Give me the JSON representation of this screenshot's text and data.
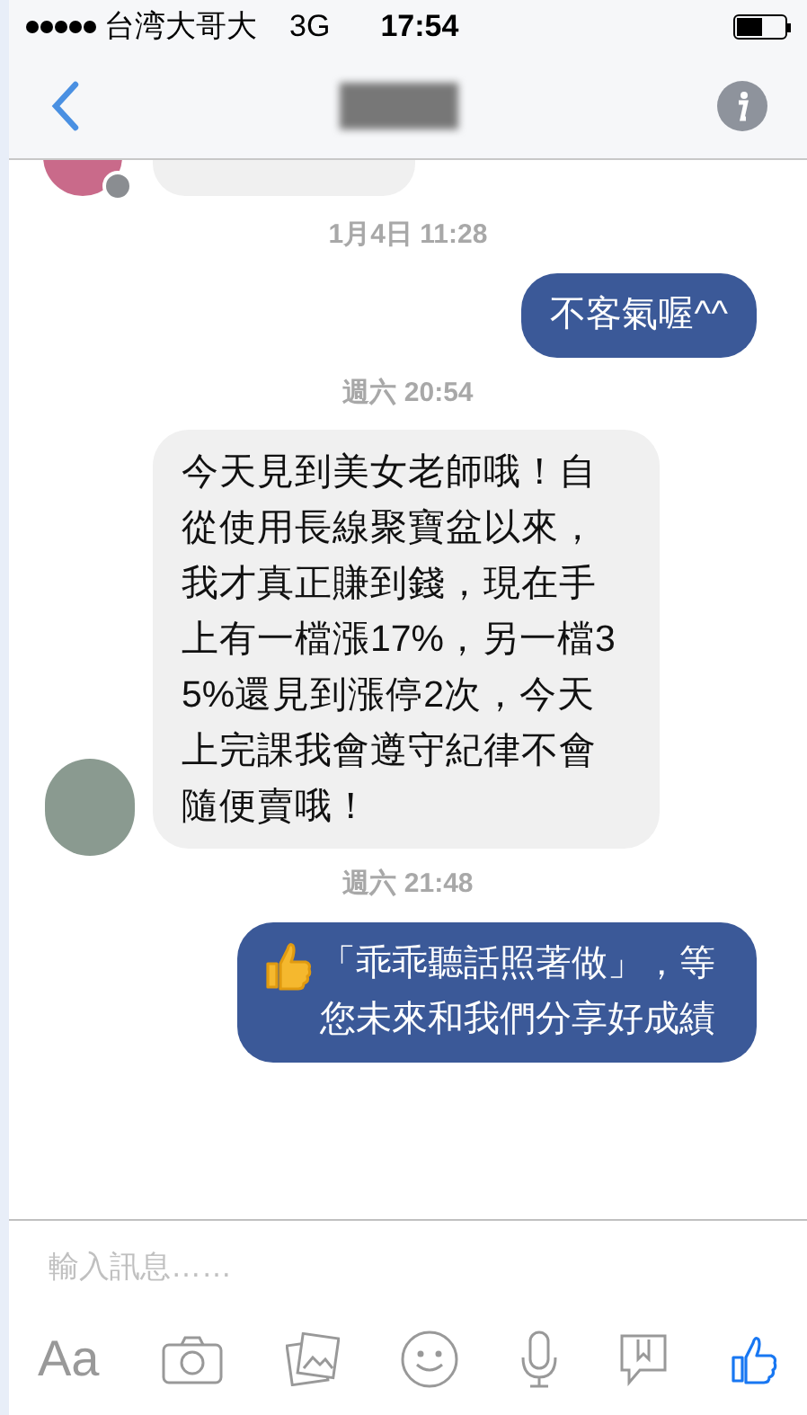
{
  "status_bar": {
    "carrier": "台湾大哥大",
    "network": "3G",
    "time": "17:54"
  },
  "messages": [
    {
      "kind": "partial_incoming"
    },
    {
      "kind": "timestamp",
      "text": "1月4日 11:28"
    },
    {
      "kind": "outgoing",
      "text": "不客氣喔^^"
    },
    {
      "kind": "timestamp",
      "text": "週六 20:54"
    },
    {
      "kind": "incoming",
      "text": "今天見到美女老師哦！自從使用長線聚寶盆以來，我才真正賺到錢，現在手上有一檔漲17%，另一檔35%還見到漲停2次，今天上完課我會遵守紀律不會隨便賣哦！"
    },
    {
      "kind": "timestamp",
      "text": "週六 21:48"
    },
    {
      "kind": "outgoing",
      "emoji": true,
      "text": "「乖乖聽話照著做」，等您未來和我們分享好成績"
    }
  ],
  "composer": {
    "placeholder": "輸入訊息……",
    "aa_label": "Aa"
  }
}
